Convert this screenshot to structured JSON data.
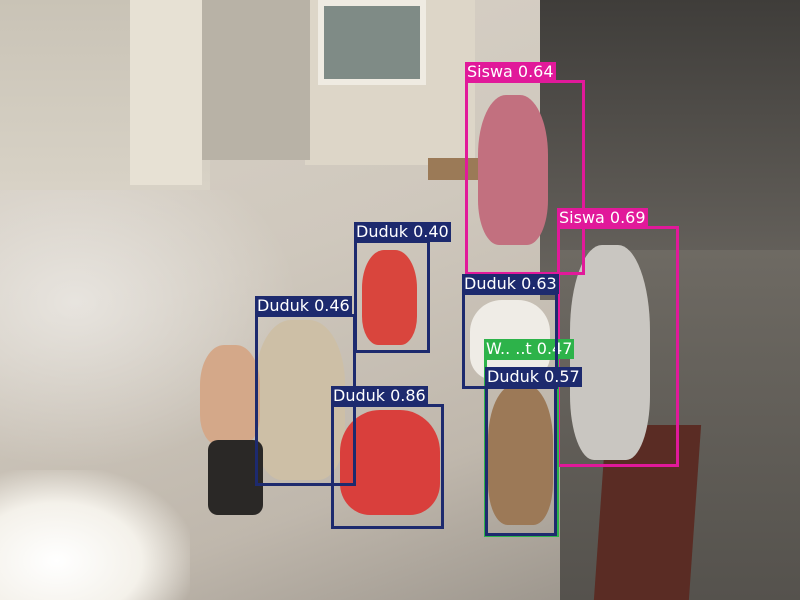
{
  "detections": [
    {
      "id": "siswa-1",
      "label": "Siswa 0.64",
      "color": "#e1199a"
    },
    {
      "id": "siswa-2",
      "label": "Siswa 0.69",
      "color": "#e1199a"
    },
    {
      "id": "duduk-1",
      "label": "Duduk 0.40",
      "color": "#1d2a6e"
    },
    {
      "id": "duduk-2",
      "label": "Duduk 0.46",
      "color": "#1d2a6e"
    },
    {
      "id": "duduk-3",
      "label": "Duduk 0.63",
      "color": "#1d2a6e"
    },
    {
      "id": "duduk-4",
      "label": "Duduk 0.86",
      "color": "#1d2a6e"
    },
    {
      "id": "duduk-5",
      "label": "Duduk 0.57",
      "color": "#1d2a6e"
    },
    {
      "id": "green-1",
      "label": "W.. ..t 0.47",
      "color": "#2db34a"
    }
  ]
}
